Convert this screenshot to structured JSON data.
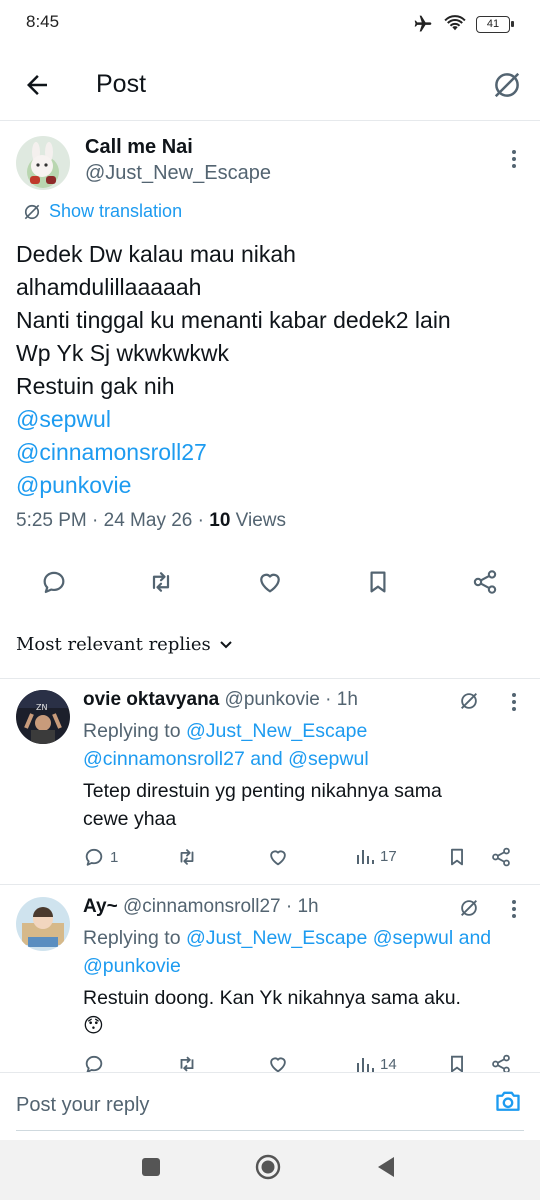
{
  "status_bar": {
    "time": "8:45",
    "battery": "41"
  },
  "header": {
    "title": "Post"
  },
  "post": {
    "author_name": "Call me Nai",
    "author_handle": "@Just_New_Escape",
    "show_translation": "Show translation",
    "lines": [
      "Dedek Dw kalau mau nikah",
      "alhamdulillaaaaah",
      "Nanti tinggal ku menanti kabar dedek2 lain",
      "Wp Yk Sj wkwkwkwk",
      "Restuin gak nih"
    ],
    "mentions": [
      "@sepwul",
      "@cinnamonsroll27",
      "@punkovie"
    ],
    "time": "5:25 PM · 24 May 26 · ",
    "views_count": "10",
    "views_label": " Views"
  },
  "sort_label": "Most relevant replies",
  "replies": [
    {
      "name": "ovie oktavyana",
      "handle_time": " @punkovie · 1h",
      "replying_prefix": "Replying to ",
      "replying_line1": "@Just_New_Escape",
      "replying_line2": "@cinnamonsroll27 and @sepwul",
      "text_line1": "Tetep direstuin yg penting nikahnya sama",
      "text_line2": "cewe yhaa",
      "reply_count": "1",
      "views": "17"
    },
    {
      "name": "Ay~",
      "handle_time": " @cinnamonsroll27 · 1h",
      "replying_prefix": "Replying to ",
      "replying_line1": "@Just_New_Escape @sepwul and",
      "replying_line2": "@punkovie",
      "text_line1": "Restuin doong. Kan Yk nikahnya sama aku.",
      "emoji": "😯",
      "views": "14"
    }
  ],
  "composer": {
    "placeholder": "Post your reply"
  },
  "colors": {
    "accent": "#1d9bf0",
    "text": "#0f1419",
    "muted": "#536471"
  }
}
